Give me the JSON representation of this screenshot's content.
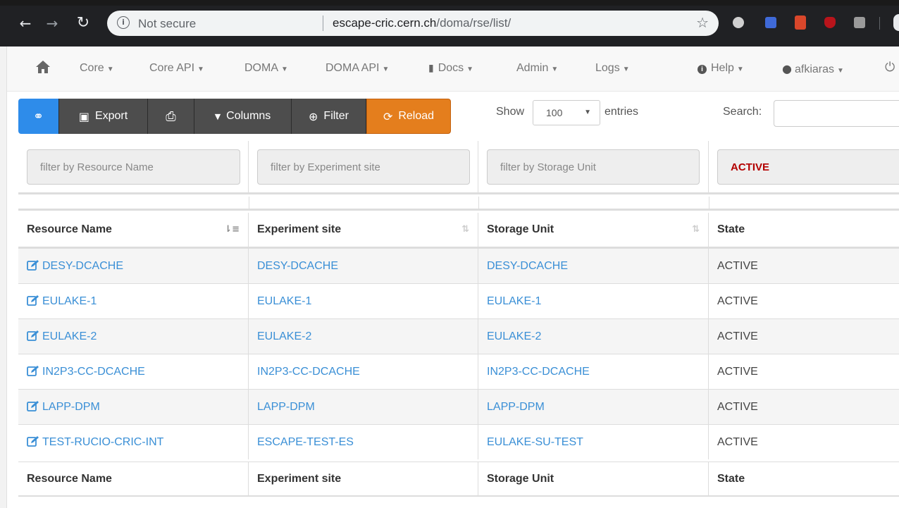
{
  "browser": {
    "security_label": "Not secure",
    "url_host": "escape-cric.cern.ch",
    "url_path": "/doma/rse/list/"
  },
  "navbar": {
    "items": [
      {
        "label": "Core"
      },
      {
        "label": "Core API"
      },
      {
        "label": "DOMA"
      },
      {
        "label": "DOMA API"
      },
      {
        "label": "Docs"
      },
      {
        "label": "Admin"
      },
      {
        "label": "Logs"
      }
    ],
    "help_label": "Help",
    "user_label": "afkiaras"
  },
  "toolbar": {
    "export_label": "Export",
    "columns_label": "Columns",
    "filter_label": "Filter",
    "reload_label": "Reload",
    "show_label": "Show",
    "page_size": "100",
    "entries_label": "entries",
    "search_label": "Search:"
  },
  "filters": {
    "resource_placeholder": "filter by Resource Name",
    "site_placeholder": "filter by Experiment site",
    "storage_placeholder": "filter by Storage Unit",
    "state_value": "ACTIVE"
  },
  "table": {
    "columns": [
      "Resource Name",
      "Experiment site",
      "Storage Unit",
      "State"
    ],
    "rows": [
      {
        "resource": "DESY-DCACHE",
        "site": "DESY-DCACHE",
        "storage": "DESY-DCACHE",
        "state": "ACTIVE"
      },
      {
        "resource": "EULAKE-1",
        "site": "EULAKE-1",
        "storage": "EULAKE-1",
        "state": "ACTIVE"
      },
      {
        "resource": "EULAKE-2",
        "site": "EULAKE-2",
        "storage": "EULAKE-2",
        "state": "ACTIVE"
      },
      {
        "resource": "IN2P3-CC-DCACHE",
        "site": "IN2P3-CC-DCACHE",
        "storage": "IN2P3-CC-DCACHE",
        "state": "ACTIVE"
      },
      {
        "resource": "LAPP-DPM",
        "site": "LAPP-DPM",
        "storage": "LAPP-DPM",
        "state": "ACTIVE"
      },
      {
        "resource": "TEST-RUCIO-CRIC-INT",
        "site": "ESCAPE-TEST-ES",
        "storage": "EULAKE-SU-TEST",
        "state": "ACTIVE"
      }
    ]
  },
  "colors": {
    "link": "#3a8fd6",
    "primary_button": "#2e8cea",
    "reload_button": "#e47e1d",
    "dark_button": "#4d4d4d",
    "active_state": "#b30000"
  }
}
